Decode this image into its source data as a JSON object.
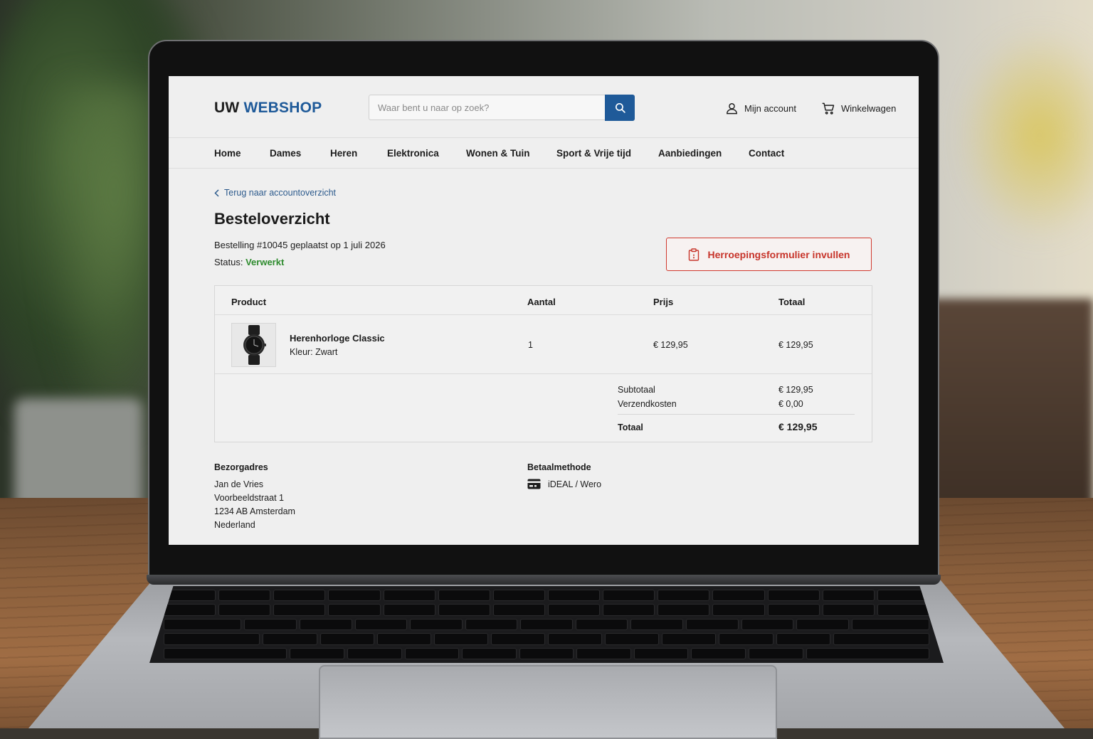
{
  "header": {
    "logo_part1": "UW",
    "logo_part2": "WEBSHOP",
    "search_placeholder": "Waar bent u naar op zoek?",
    "account_label": "Mijn account",
    "cart_label": "Winkelwagen"
  },
  "nav": {
    "items": [
      "Home",
      "Dames",
      "Heren",
      "Elektronica",
      "Wonen & Tuin",
      "Sport & Vrije tijd",
      "Aanbiedingen",
      "Contact"
    ]
  },
  "page": {
    "back_link": "Terug naar accountoverzicht",
    "title": "Besteloverzicht",
    "order_info": "Bestelling #10045 geplaatst op 1 juli 2026",
    "status_label": "Status:",
    "status_value": "Verwerkt",
    "withdraw_button": "Herroepingsformulier invullen"
  },
  "order_table": {
    "headers": [
      "Product",
      "Aantal",
      "Prijs",
      "Totaal"
    ],
    "rows": [
      {
        "name": "Herenhorloge Classic",
        "variant": "Kleur: Zwart",
        "quantity": "1",
        "price": "€ 129,95",
        "total": "€ 129,95",
        "image": "watch-image"
      }
    ],
    "summary": {
      "subtotal_label": "Subtotaal",
      "subtotal_value": "€ 129,95",
      "shipping_label": "Verzendkosten",
      "shipping_value": "€ 0,00",
      "total_label": "Totaal",
      "total_value": "€ 129,95"
    }
  },
  "delivery": {
    "title": "Bezorgadres",
    "lines": [
      "Jan de Vries",
      "Voorbeeldstraat 1",
      "1234 AB Amsterdam",
      "Nederland"
    ]
  },
  "payment": {
    "title": "Betaalmethode",
    "method": "iDEAL / Wero",
    "icon": "payment-card-icon"
  },
  "colors": {
    "brand_blue": "#1f5a99",
    "status_green": "#2e8b2e",
    "withdraw_red": "#c7342a"
  }
}
